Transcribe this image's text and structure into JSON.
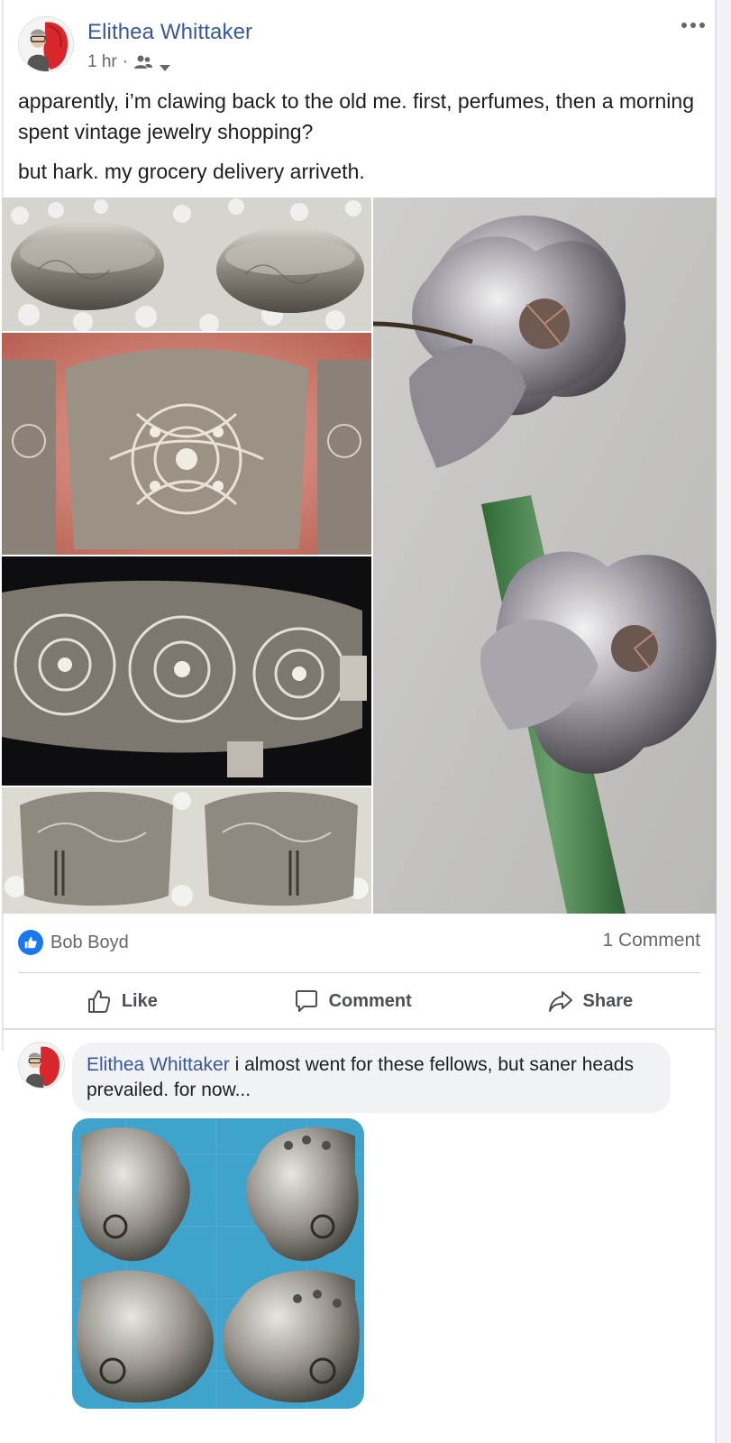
{
  "post": {
    "author": "Elithea Whittaker",
    "time": "1 hr",
    "separator": "·",
    "audience_icon": "friends-icon",
    "text_line1": "apparently, i’m clawing back to the old me. first, perfumes, then a morning spent vintage jewelry shopping?",
    "text_line2": "but hark. my grocery delivery arriveth."
  },
  "photos": [
    {
      "icon": "bracelet-pair-photo"
    },
    {
      "icon": "filigree-bracelet-photo"
    },
    {
      "icon": "filigree-panel-bracelet-photo"
    },
    {
      "icon": "hinged-bracelet-pair-photo"
    },
    {
      "icon": "flower-earrings-photo"
    }
  ],
  "reactions": {
    "names": "Bob Boyd",
    "comment_count": "1 Comment"
  },
  "actions": {
    "like": "Like",
    "comment": "Comment",
    "share": "Share"
  },
  "comment": {
    "author": "Elithea Whittaker",
    "text": " i almost went for these fellows, but saner heads prevailed. for now...",
    "photo_icon": "pirate-earrings-photo"
  },
  "colors": {
    "link": "#385898",
    "like_blue": "#1877f2",
    "muted": "#65676b",
    "bubble": "#f0f2f5"
  }
}
